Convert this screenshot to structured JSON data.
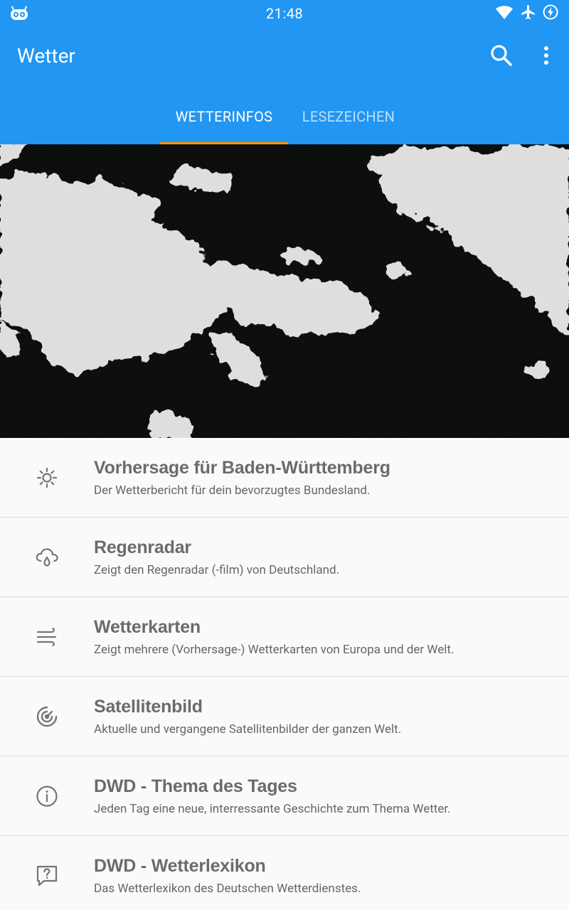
{
  "status_bar": {
    "time": "21:48",
    "left_icon": "cyanogen-icon",
    "right_icons": [
      "wifi-icon",
      "airplane-icon",
      "battery-charging-icon"
    ]
  },
  "app_bar": {
    "title": "Wetter",
    "actions": [
      "search-icon",
      "more-vert-icon"
    ],
    "background": "#2196f3"
  },
  "tabs": [
    {
      "label": "WETTERINFOS",
      "active": true
    },
    {
      "label": "LESEZEICHEN",
      "active": false
    }
  ],
  "tab_indicator_color": "#ff9800",
  "hero": {
    "image": "satellite-clouds-image"
  },
  "items": [
    {
      "icon": "sun-icon",
      "title": "Vorhersage für Baden-Württemberg",
      "subtitle": "Der Wetterbericht für dein bevorzugtes Bundesland."
    },
    {
      "icon": "rain-cloud-icon",
      "title": "Regenradar",
      "subtitle": "Zeigt den Regenradar (-film) von Deutschland."
    },
    {
      "icon": "wind-icon",
      "title": "Wetterkarten",
      "subtitle": "Zeigt mehrere (Vorhersage-) Wetterkarten von Europa und der Welt."
    },
    {
      "icon": "radar-icon",
      "title": "Satellitenbild",
      "subtitle": "Aktuelle und vergangene Satellitenbilder der ganzen Welt."
    },
    {
      "icon": "info-icon",
      "title": "DWD - Thema des Tages",
      "subtitle": "Jeden Tag eine neue, interressante Geschichte zum Thema Wetter."
    },
    {
      "icon": "help-bubble-icon",
      "title": "DWD - Wetterlexikon",
      "subtitle": "Das Wetterlexikon des Deutschen Wetterdienstes."
    }
  ]
}
